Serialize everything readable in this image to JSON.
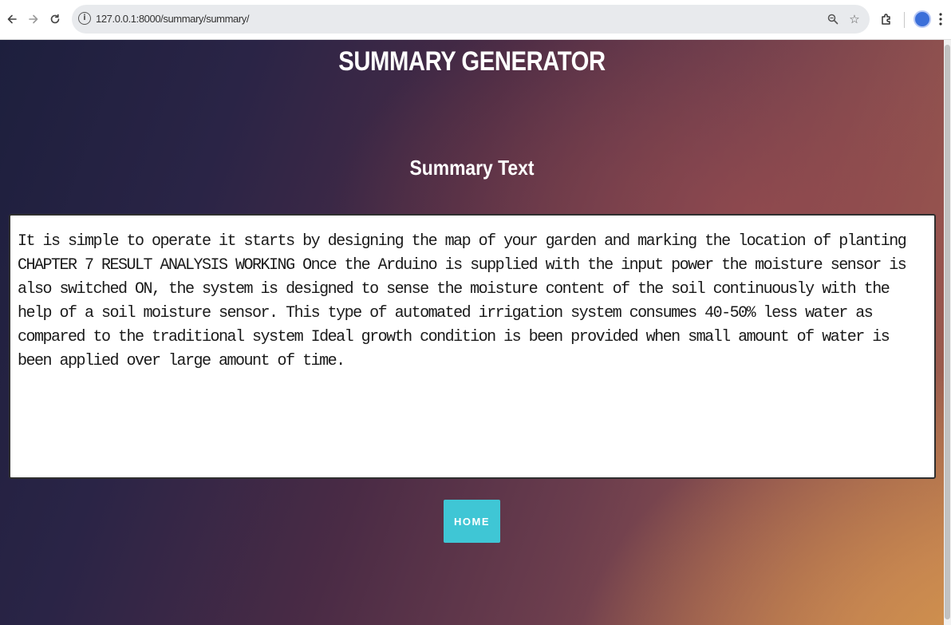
{
  "browser": {
    "url": "127.0.0.1:8000/summary/summary/",
    "back_icon": "arrow-left",
    "forward_icon": "arrow-right",
    "reload_icon": "reload",
    "info_icon": "info-circle",
    "zoom_icon": "magnifier",
    "bookmark_icon": "star",
    "extensions_icon": "puzzle-piece",
    "menu_icon": "vertical-dots"
  },
  "page": {
    "title": "SUMMARY GENERATOR",
    "subtitle": "Summary Text",
    "summary_text": "It is simple to operate it starts by designing the map of your garden and marking the location of planting CHAPTER 7 RESULT ANALYSIS WORKING Once the Arduino is supplied with the input power the moisture sensor is also switched ON, the system is designed to sense the moisture content of the soil continuously with the help of a soil moisture sensor. This type of automated irrigation system consumes 40-50% less water as compared to the traditional system Ideal growth condition is been provided when small amount of water is been applied over large amount of time.",
    "home_button": "HOME"
  },
  "colors": {
    "accent_button": "#3fc6d5",
    "background_dark": "#1d1f3d",
    "background_warm": "#d79a4c"
  }
}
